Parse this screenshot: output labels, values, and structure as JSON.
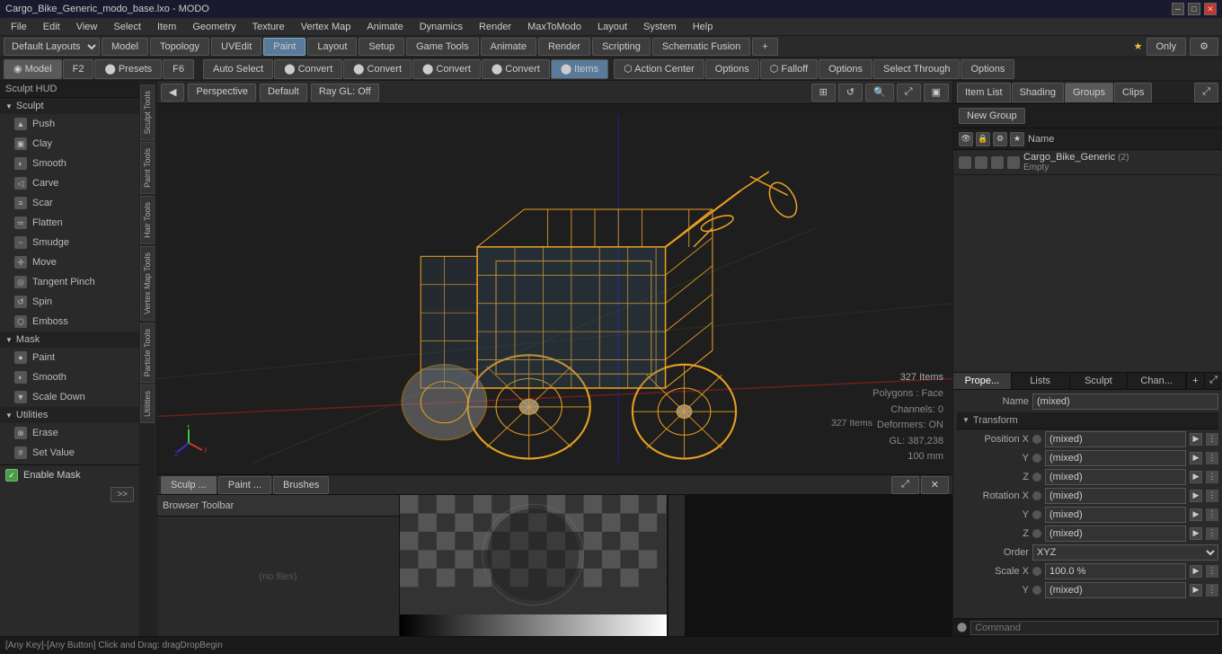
{
  "titlebar": {
    "title": "Cargo_Bike_Generic_modo_base.lxo - MODO",
    "controls": [
      "─",
      "□",
      "✕"
    ]
  },
  "menubar": {
    "items": [
      "File",
      "Edit",
      "View",
      "Select",
      "Item",
      "Geometry",
      "Texture",
      "Vertex Map",
      "Animate",
      "Dynamics",
      "Render",
      "MaxToModo",
      "Layout",
      "System",
      "Help"
    ]
  },
  "toolbar1": {
    "layouts_label": "Default Layouts",
    "model_btn": "Model",
    "topology_btn": "Topology",
    "uvedit_btn": "UVEdit",
    "paint_btn": "Paint",
    "layout_btn": "Layout",
    "setup_btn": "Setup",
    "gametools_btn": "Game Tools",
    "animate_btn": "Animate",
    "render_btn": "Render",
    "scripting_btn": "Scripting",
    "schematic_btn": "Schematic Fusion",
    "plus_btn": "+"
  },
  "toolbar2": {
    "model_tab": "◉ Model",
    "f2_btn": "F2",
    "presets_btn": "⬤ Presets",
    "f6_btn": "F6",
    "auto_select": "Auto Select",
    "convert1": "Convert",
    "convert2": "Convert",
    "convert3": "Convert",
    "convert4": "Convert",
    "items_btn": "Items",
    "action_center": "Action Center",
    "options1": "Options",
    "falloff": "Falloff",
    "options2": "Options",
    "select_through": "Select Through",
    "options3": "Options",
    "star_only": "★ Only",
    "gear_btn": "⚙"
  },
  "sculpt_panel": {
    "header": "Sculpt HUD",
    "sections": [
      {
        "name": "Sculpt",
        "tools": [
          "Push",
          "Clay",
          "Smooth",
          "Carve",
          "Scar",
          "Flatten",
          "Smudge",
          "Move",
          "Tangent Pinch",
          "Spin",
          "Emboss"
        ]
      },
      {
        "name": "Mask",
        "tools": [
          "Paint",
          "Smooth",
          "Scale Down"
        ]
      },
      {
        "name": "Utilities",
        "tools": [
          "Erase",
          "Set Value"
        ]
      }
    ],
    "enable_mask": "Enable Mask"
  },
  "side_tabs": [
    "Sculpt Tools",
    "Paint Tools",
    "Hair Tools",
    "Vertex Map Tools",
    "Particle Tools",
    "Utilities"
  ],
  "viewport": {
    "perspective_btn": "Perspective",
    "default_btn": "Default",
    "raygl_btn": "Ray GL: Off",
    "stats": {
      "items_count": "327 Items",
      "polygons": "Polygons : Face",
      "channels": "Channels: 0",
      "deformers": "Deformers: ON",
      "gl_info": "GL: 387,238",
      "distance": "100 mm"
    }
  },
  "bottom_panel": {
    "tabs": [
      "Sculp ...",
      "Paint ...",
      "Brushes"
    ],
    "browser_toolbar": "Browser Toolbar",
    "no_files": "(no files)"
  },
  "right_panel": {
    "tabs": [
      "Item List",
      "Shading",
      "Groups",
      "Clips"
    ],
    "new_group_btn": "New Group",
    "columns": {
      "icons": [
        "👁",
        "🔒",
        "⚙",
        "★"
      ],
      "name": "Name"
    },
    "items": [
      {
        "name": "Cargo_Bike_Generic",
        "badge": "(2)",
        "sub": "Empty",
        "selected": false
      }
    ]
  },
  "properties": {
    "tabs": [
      "Prope...",
      "Lists",
      "Sculpt",
      "Chan..."
    ],
    "name_label": "Name",
    "name_value": "(mixed)",
    "transform": {
      "header": "Transform",
      "position_x": "(mixed)",
      "position_y": "(mixed)",
      "position_z": "(mixed)",
      "rotation_x": "(mixed)",
      "rotation_y": "(mixed)",
      "rotation_z": "(mixed)",
      "order_label": "Order",
      "order_value": "XYZ",
      "scale_x_label": "Scale X",
      "scale_x_value": "100.0 %",
      "scale_y_label": "Y",
      "scale_y_value": "(mixed)"
    }
  },
  "status_bar": {
    "text": "[Any Key]-[Any Button] Click and Drag:  dragDropBegin"
  },
  "command_bar": {
    "prompt": "⬤",
    "placeholder": "Command"
  }
}
